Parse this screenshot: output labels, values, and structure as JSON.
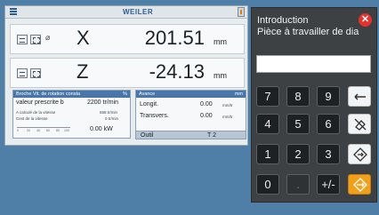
{
  "brand": "WEILER",
  "axes": [
    {
      "name": "X",
      "value": "201.51",
      "unit": "mm",
      "prefix": "⌀"
    },
    {
      "name": "Z",
      "value": "-24.13",
      "unit": "mm",
      "prefix": ""
    }
  ],
  "spindle": {
    "header": "Broche   Vit. de rotation consta",
    "header_right": "%",
    "row1_label": "valeur prescrite b",
    "row1_value": "2200 tr/min",
    "row2_label": "A calculé de la vitesse",
    "row2_value": "658 tr/min",
    "row3_label": "Cest de la vitesse",
    "row3_value": "0 tr/min",
    "ruler": [
      "0",
      "20",
      "40",
      "60",
      "80",
      "100"
    ],
    "power": "0.00 kW"
  },
  "feed": {
    "header": "Avance",
    "header_right": "mm",
    "row1_label": "Longit.",
    "row1_value": "0.00",
    "row1_unit": "mm/tr",
    "row2_label": "Transvers.",
    "row2_value": "0.00",
    "row2_unit": "mm/tr",
    "tool_label": "Outil",
    "tool_value": "T 2"
  },
  "dialog": {
    "title": "Introduction",
    "subtitle": "Pièce à travailler de dia",
    "input_value": "",
    "keys": [
      "7",
      "8",
      "9",
      "4",
      "5",
      "6",
      "1",
      "2",
      "3",
      "0",
      ".",
      "+/-"
    ]
  },
  "colors": {
    "accent": "#4876a8",
    "close": "#e5322d",
    "enter": "#f0a01a",
    "background": "#4f7fa6"
  }
}
